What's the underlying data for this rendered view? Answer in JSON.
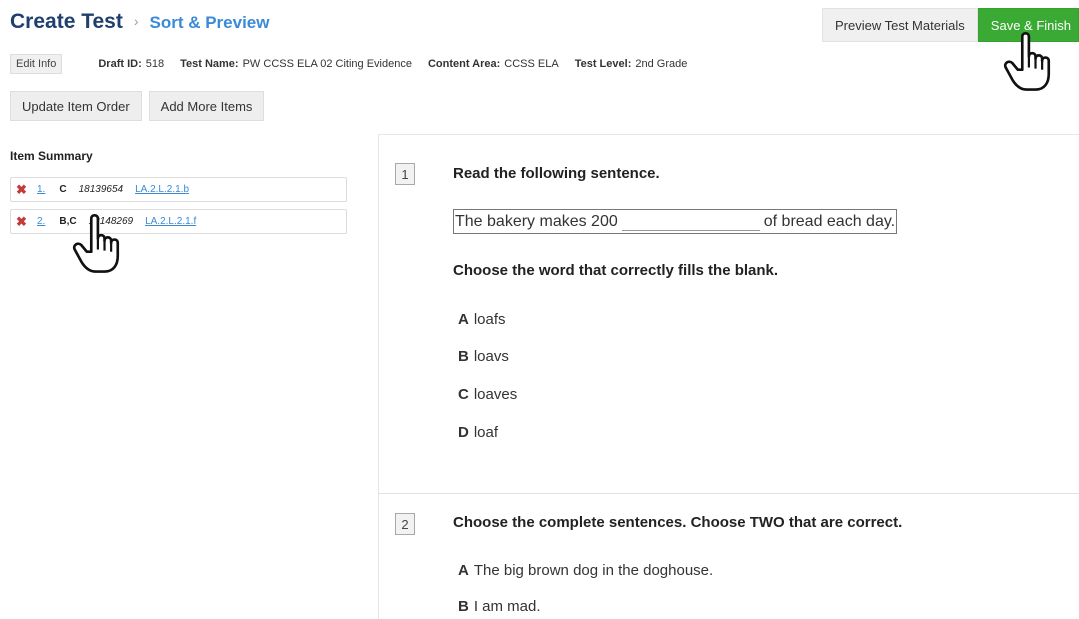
{
  "header": {
    "title": "Create Test",
    "separator": "›",
    "subtitle": "Sort & Preview",
    "preview_button": "Preview Test Materials",
    "save_button": "Save & Finish"
  },
  "info": {
    "edit_button": "Edit Info",
    "draft_id_label": "Draft ID:",
    "draft_id": "518",
    "test_name_label": "Test Name:",
    "test_name": "PW CCSS ELA 02 Citing Evidence",
    "content_area_label": "Content Area:",
    "content_area": "CCSS ELA",
    "test_level_label": "Test Level:",
    "test_level": "2nd Grade"
  },
  "actions": {
    "update_order": "Update Item Order",
    "add_items": "Add More Items"
  },
  "summary": {
    "title": "Item Summary",
    "items": [
      {
        "num": "1.",
        "key": "C",
        "id": "18139654",
        "standard": "LA.2.L.2.1.b"
      },
      {
        "num": "2.",
        "key": "B,C",
        "id": "18148269",
        "standard": "LA.2.L.2.1.f"
      }
    ]
  },
  "questions": [
    {
      "number": "1",
      "prompt": "Read the following sentence.",
      "passage_before": "The bakery makes 200",
      "passage_after": "of bread each day.",
      "instruction": "Choose the word that correctly fills the blank.",
      "choices": [
        {
          "letter": "A",
          "text": "loafs"
        },
        {
          "letter": "B",
          "text": "loavs"
        },
        {
          "letter": "C",
          "text": "loaves"
        },
        {
          "letter": "D",
          "text": "loaf"
        }
      ]
    },
    {
      "number": "2",
      "prompt": "Choose the complete sentences.  Choose TWO that are correct.",
      "choices": [
        {
          "letter": "A",
          "text": "The big brown dog in the doghouse."
        },
        {
          "letter": "B",
          "text": "I am mad."
        }
      ]
    }
  ],
  "colors": {
    "title": "#1f3f6f",
    "accent_link": "#3a8ad6",
    "save_green": "#3aaa35",
    "delete_red": "#c43b3b"
  }
}
